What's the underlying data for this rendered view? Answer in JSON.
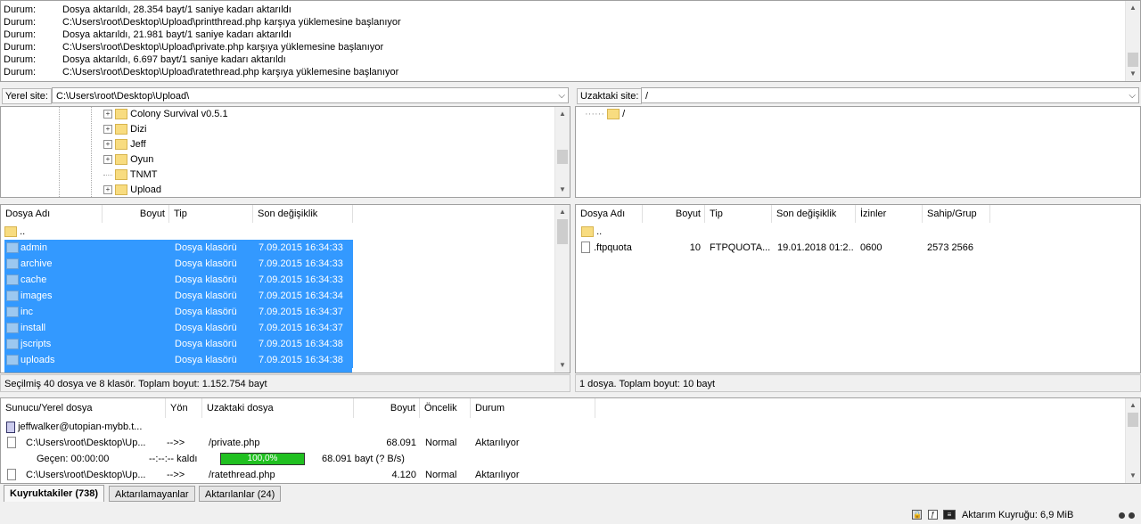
{
  "log": [
    {
      "label": "Durum:",
      "text": "Dosya aktarıldı, 28.354 bayt/1 saniye kadarı aktarıldı"
    },
    {
      "label": "Durum:",
      "text": "C:\\Users\\root\\Desktop\\Upload\\printthread.php karşıya yüklemesine başlanıyor"
    },
    {
      "label": "Durum:",
      "text": "Dosya aktarıldı, 21.981 bayt/1 saniye kadarı aktarıldı"
    },
    {
      "label": "Durum:",
      "text": "C:\\Users\\root\\Desktop\\Upload\\private.php karşıya yüklemesine başlanıyor"
    },
    {
      "label": "Durum:",
      "text": "Dosya aktarıldı, 6.697 bayt/1 saniye kadarı aktarıldı"
    },
    {
      "label": "Durum:",
      "text": "C:\\Users\\root\\Desktop\\Upload\\ratethread.php karşıya yüklemesine başlanıyor"
    }
  ],
  "local": {
    "site_label": "Yerel site:",
    "site_path": "C:\\Users\\root\\Desktop\\Upload\\",
    "tree": [
      "Colony Survival v0.5.1",
      "Dizi",
      "Jeff",
      "Oyun",
      "TNMT",
      "Upload"
    ],
    "columns": [
      "Dosya Adı",
      "Boyut",
      "Tip",
      "Son değişiklik"
    ],
    "parent": "..",
    "rows": [
      {
        "name": "admin",
        "type": "Dosya klasörü",
        "modified": "7.09.2015 16:34:33"
      },
      {
        "name": "archive",
        "type": "Dosya klasörü",
        "modified": "7.09.2015 16:34:33"
      },
      {
        "name": "cache",
        "type": "Dosya klasörü",
        "modified": "7.09.2015 16:34:33"
      },
      {
        "name": "images",
        "type": "Dosya klasörü",
        "modified": "7.09.2015 16:34:34"
      },
      {
        "name": "inc",
        "type": "Dosya klasörü",
        "modified": "7.09.2015 16:34:37"
      },
      {
        "name": "install",
        "type": "Dosya klasörü",
        "modified": "7.09.2015 16:34:37"
      },
      {
        "name": "jscripts",
        "type": "Dosya klasörü",
        "modified": "7.09.2015 16:34:38"
      },
      {
        "name": "uploads",
        "type": "Dosya klasörü",
        "modified": "7.09.2015 16:34:38"
      }
    ],
    "status": "Seçilmiş 40 dosya ve 8 klasör. Toplam boyut: 1.152.754 bayt"
  },
  "remote": {
    "site_label": "Uzaktaki site:",
    "site_path": "/",
    "tree_root": "/",
    "columns": [
      "Dosya Adı",
      "Boyut",
      "Tip",
      "Son değişiklik",
      "İzinler",
      "Sahip/Grup"
    ],
    "parent": "..",
    "rows": [
      {
        "name": ".ftpquota",
        "size": "10",
        "type": "FTPQUOTA...",
        "modified": "19.01.2018 01:2...",
        "perms": "0600",
        "owner": "2573 2566"
      }
    ],
    "status": "1 dosya. Toplam boyut: 10 bayt"
  },
  "queue": {
    "columns": [
      "Sunucu/Yerel dosya",
      "Yön",
      "Uzaktaki dosya",
      "Boyut",
      "Öncelik",
      "Durum"
    ],
    "server": "jeffwalker@utopian-mybb.t...",
    "items": [
      {
        "local": "C:\\Users\\root\\Desktop\\Up...",
        "dir": "-->>",
        "remote": "/private.php",
        "size": "68.091",
        "priority": "Normal",
        "status": "Aktarılıyor"
      },
      {
        "local": "C:\\Users\\root\\Desktop\\Up...",
        "dir": "-->>",
        "remote": "/ratethread.php",
        "size": "4.120",
        "priority": "Normal",
        "status": "Aktarılıyor"
      }
    ],
    "progress": {
      "elapsed": "Geçen: 00:00:00",
      "remaining": "--:--:-- kaldı",
      "percent_label": "100,0%",
      "percent": 100,
      "bytes": "68.091 bayt (? B/s)"
    }
  },
  "tabs": [
    "Kuyruktakiler (738)",
    "Aktarılamayanlar",
    "Aktarılanlar (24)"
  ],
  "statusbar": {
    "queue": "Aktarım Kuyruğu: 6,9 MiB"
  },
  "colors": {
    "selection": "#3399ff",
    "progress": "#20c020"
  }
}
